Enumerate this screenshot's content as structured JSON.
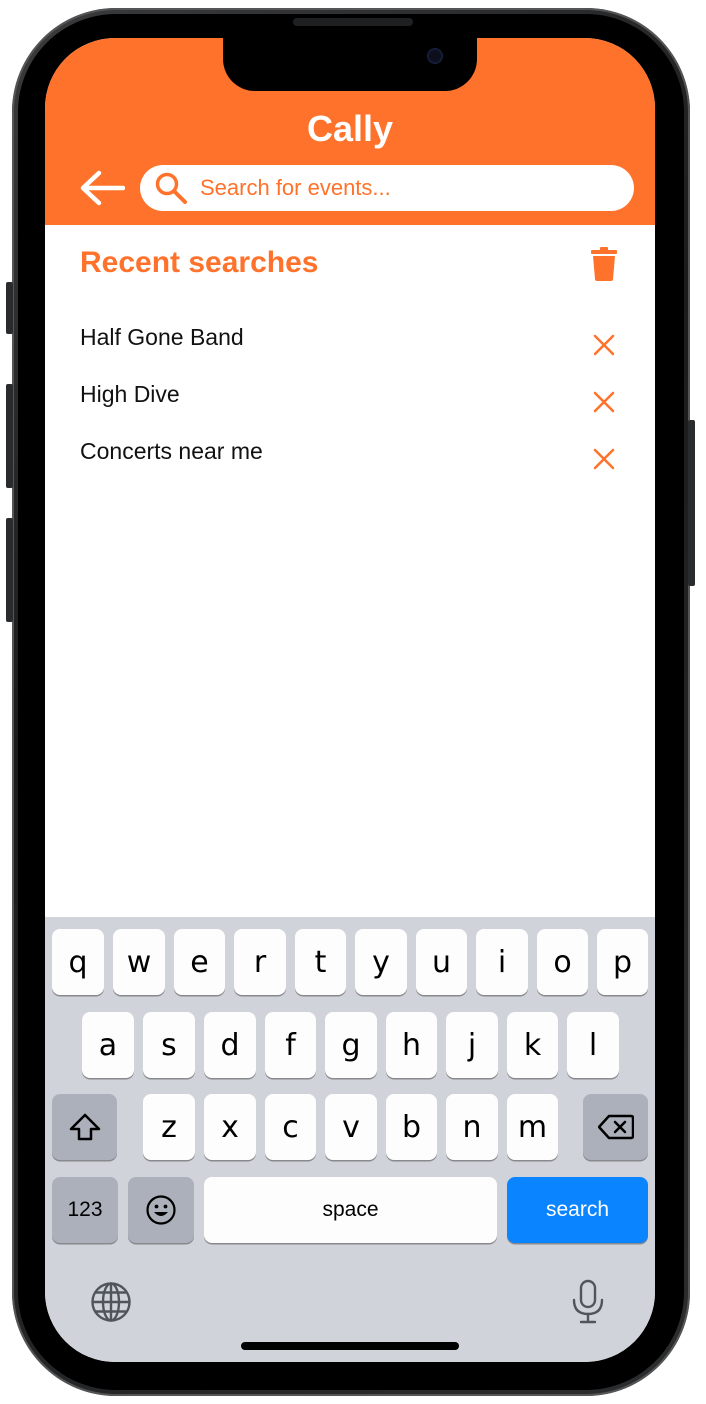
{
  "app": {
    "title": "Cally"
  },
  "search": {
    "placeholder": "Search for events..."
  },
  "recent": {
    "title": "Recent searches",
    "items": [
      {
        "label": "Half Gone Band"
      },
      {
        "label": "High Dive"
      },
      {
        "label": "Concerts near me"
      }
    ]
  },
  "keyboard": {
    "row1": [
      "q",
      "w",
      "e",
      "r",
      "t",
      "y",
      "u",
      "i",
      "o",
      "p"
    ],
    "row2": [
      "a",
      "s",
      "d",
      "f",
      "g",
      "h",
      "j",
      "k",
      "l"
    ],
    "row3": [
      "z",
      "x",
      "c",
      "v",
      "b",
      "n",
      "m"
    ],
    "numbers_label": "123",
    "space_label": "space",
    "search_label": "search"
  },
  "colors": {
    "accent": "#ff722b",
    "keyboard_bg": "#d0d3d9",
    "search_key": "#0a84ff"
  },
  "icons": {
    "back": "arrow-left-icon",
    "search": "magnifier-icon",
    "trash": "trash-icon",
    "remove": "close-icon",
    "shift": "shift-icon",
    "delete": "backspace-icon",
    "emoji": "emoji-icon",
    "globe": "globe-icon",
    "mic": "microphone-icon"
  }
}
